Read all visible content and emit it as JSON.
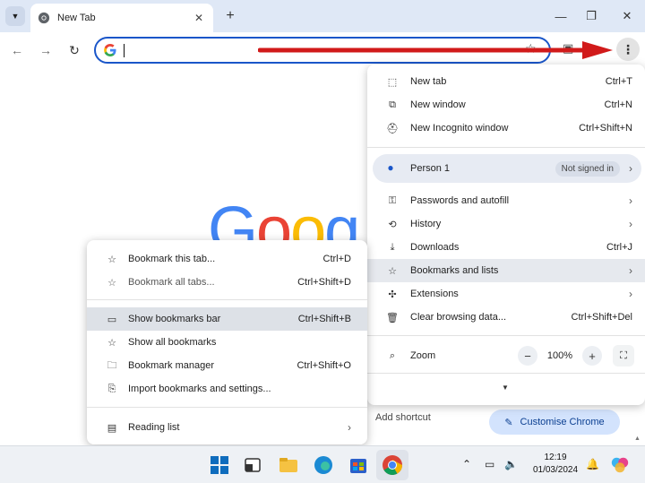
{
  "browser": {
    "tab_title": "New Tab",
    "omnibox_value": "",
    "colors": {
      "accent": "#1a56c9",
      "arrow": "#d11a1a",
      "highlight": "#e6e9ee",
      "customise_bg": "#d3e3fd"
    }
  },
  "page": {
    "logo_letters": [
      "G",
      "o",
      "o",
      "g"
    ],
    "add_shortcut": "Add shortcut",
    "customise_label": "Customise Chrome"
  },
  "main_menu": {
    "items": [
      {
        "icon": "new-tab-icon",
        "label": "New tab",
        "shortcut": "Ctrl+T"
      },
      {
        "icon": "new-window-icon",
        "label": "New window",
        "shortcut": "Ctrl+N"
      },
      {
        "icon": "incognito-icon",
        "label": "New Incognito window",
        "shortcut": "Ctrl+Shift+N"
      }
    ],
    "person": {
      "label": "Person 1",
      "status": "Not signed in"
    },
    "items2": [
      {
        "icon": "key-icon",
        "label": "Passwords and autofill",
        "shortcut": ""
      },
      {
        "icon": "history-icon",
        "label": "History",
        "shortcut": ""
      },
      {
        "icon": "download-icon",
        "label": "Downloads",
        "shortcut": "Ctrl+J"
      },
      {
        "icon": "star-icon",
        "label": "Bookmarks and lists",
        "shortcut": ""
      },
      {
        "icon": "puzzle-icon",
        "label": "Extensions",
        "shortcut": ""
      },
      {
        "icon": "trash-icon",
        "label": "Clear browsing data...",
        "shortcut": "Ctrl+Shift+Del"
      }
    ],
    "zoom": {
      "label": "Zoom",
      "value": "100%",
      "minus": "−",
      "plus": "+"
    }
  },
  "bookmarks_menu": {
    "items": [
      {
        "label": "Bookmark this tab...",
        "shortcut": "Ctrl+D"
      },
      {
        "label": "Bookmark all tabs...",
        "shortcut": "Ctrl+Shift+D"
      },
      {
        "label": "Show bookmarks bar",
        "shortcut": "Ctrl+Shift+B"
      },
      {
        "label": "Show all bookmarks",
        "shortcut": ""
      },
      {
        "label": "Bookmark manager",
        "shortcut": "Ctrl+Shift+O"
      },
      {
        "label": "Import bookmarks and settings...",
        "shortcut": ""
      },
      {
        "label": "Reading list",
        "shortcut": ""
      }
    ]
  },
  "taskbar": {
    "time": "12:19",
    "date": "01/03/2024"
  }
}
